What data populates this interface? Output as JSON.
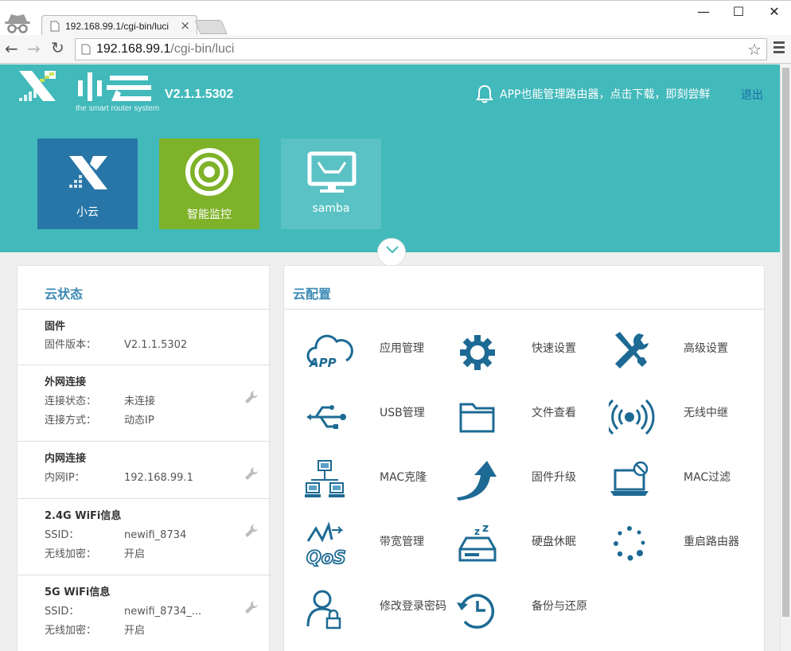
{
  "browser": {
    "tab_title": "192.168.99.1/cgi-bin/luci",
    "tab_close": "×",
    "url_host": "192.168.99.1",
    "url_path": "/cgi-bin/luci",
    "window_buttons": {
      "minimize": "—",
      "maximize": "☐",
      "close": "✕"
    }
  },
  "header": {
    "logo_text": "小云",
    "logo_tagline": "the smart router system",
    "version": "V2.1.1.5302",
    "promo": "APP也能管理路由器，点击下载，即刻尝鲜",
    "logout": "退出",
    "background_color": "#42b9bb"
  },
  "tiles": [
    {
      "label": "小云",
      "color": "#2876a8"
    },
    {
      "label": "智能监控",
      "color": "#7eb228"
    },
    {
      "label": "samba",
      "color": "#5ac2c4"
    }
  ],
  "status": {
    "title": "云状态",
    "sections": [
      {
        "title": "固件",
        "rows": [
          {
            "key": "固件版本：",
            "value": "V2.1.1.5302"
          }
        ]
      },
      {
        "title": "外网连接",
        "rows": [
          {
            "key": "连接状态：",
            "value": "未连接"
          },
          {
            "key": "连接方式：",
            "value": "动态IP"
          }
        ]
      },
      {
        "title": "内网连接",
        "rows": [
          {
            "key": "内网IP：",
            "value": "192.168.99.1"
          }
        ]
      },
      {
        "title": "2.4G WiFi信息",
        "rows": [
          {
            "key": "SSID：",
            "value": "newifi_8734"
          },
          {
            "key": "无线加密：",
            "value": "开启"
          }
        ]
      },
      {
        "title": "5G WiFi信息",
        "rows": [
          {
            "key": "SSID：",
            "value": "newifi_8734_..."
          },
          {
            "key": "无线加密：",
            "value": "开启"
          }
        ]
      }
    ]
  },
  "config": {
    "title": "云配置",
    "accent_color": "#1d6a94",
    "items": [
      {
        "label": "应用管理",
        "icon": "app-cloud-icon"
      },
      {
        "label": "快速设置",
        "icon": "gear-icon"
      },
      {
        "label": "高级设置",
        "icon": "tools-icon"
      },
      {
        "label": "USB管理",
        "icon": "usb-icon"
      },
      {
        "label": "文件查看",
        "icon": "folder-icon"
      },
      {
        "label": "无线中继",
        "icon": "wireless-icon"
      },
      {
        "label": "MAC克隆",
        "icon": "network-computers-icon"
      },
      {
        "label": "固件升级",
        "icon": "upgrade-arrow-icon"
      },
      {
        "label": "MAC过滤",
        "icon": "laptop-block-icon"
      },
      {
        "label": "带宽管理",
        "icon": "qos-icon"
      },
      {
        "label": "硬盘休眠",
        "icon": "disk-sleep-icon"
      },
      {
        "label": "重启路由器",
        "icon": "restart-dots-icon"
      },
      {
        "label": "修改登录密码",
        "icon": "user-lock-icon"
      },
      {
        "label": "备份与还原",
        "icon": "backup-restore-icon"
      }
    ]
  }
}
